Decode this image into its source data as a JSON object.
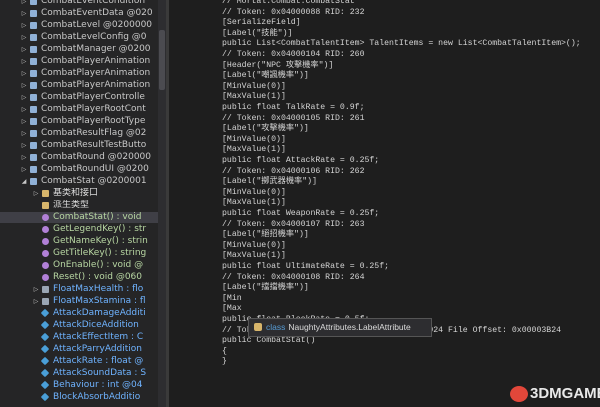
{
  "tree": {
    "rows": [
      {
        "label": "CombatEventCondition",
        "indent": 1,
        "icon": "cls",
        "style": "type",
        "expander": "▷"
      },
      {
        "label": "CombatEventData @020",
        "indent": 1,
        "icon": "cls",
        "style": "type",
        "expander": "▷"
      },
      {
        "label": "CombatLevel @0200000",
        "indent": 1,
        "icon": "cls",
        "style": "type",
        "expander": "▷"
      },
      {
        "label": "CombatLevelConfig @0",
        "indent": 1,
        "icon": "cls",
        "style": "type",
        "expander": "▷"
      },
      {
        "label": "CombatManager @0200",
        "indent": 1,
        "icon": "cls",
        "style": "type",
        "expander": "▷"
      },
      {
        "label": "CombatPlayerAnimation",
        "indent": 1,
        "icon": "cls",
        "style": "type",
        "expander": "▷"
      },
      {
        "label": "CombatPlayerAnimation",
        "indent": 1,
        "icon": "cls",
        "style": "type",
        "expander": "▷"
      },
      {
        "label": "CombatPlayerAnimation",
        "indent": 1,
        "icon": "cls",
        "style": "type",
        "expander": "▷"
      },
      {
        "label": "CombatPlayerControlle",
        "indent": 1,
        "icon": "cls",
        "style": "type",
        "expander": "▷"
      },
      {
        "label": "CombatPlayerRootCont",
        "indent": 1,
        "icon": "cls",
        "style": "type",
        "expander": "▷"
      },
      {
        "label": "CombatPlayerRootType",
        "indent": 1,
        "icon": "cls",
        "style": "type",
        "expander": "▷"
      },
      {
        "label": "CombatResultFlag @02",
        "indent": 1,
        "icon": "cls",
        "style": "type",
        "expander": "▷"
      },
      {
        "label": "CombatResultTestButto",
        "indent": 1,
        "icon": "cls",
        "style": "type",
        "expander": "▷"
      },
      {
        "label": "CombatRound @020000",
        "indent": 1,
        "icon": "cls",
        "style": "type",
        "expander": "▷"
      },
      {
        "label": "CombatRoundUI @0200",
        "indent": 1,
        "icon": "cls",
        "style": "type",
        "expander": "▷"
      },
      {
        "label": "CombatStat @0200001",
        "indent": 1,
        "icon": "cls",
        "style": "type",
        "expander": "◢"
      },
      {
        "label": "基类和接口",
        "indent": 2,
        "icon": "fold",
        "style": "folder",
        "expander": "▷"
      },
      {
        "label": "派生类型",
        "indent": 2,
        "icon": "fold",
        "style": "folder",
        "expander": ""
      },
      {
        "label": "CombatStat() : void",
        "indent": 2,
        "icon": "meth",
        "style": "method",
        "expander": "",
        "selected": true
      },
      {
        "label": "GetLegendKey() : str",
        "indent": 2,
        "icon": "meth",
        "style": "method",
        "expander": ""
      },
      {
        "label": "GetNameKey() : strin",
        "indent": 2,
        "icon": "meth",
        "style": "method",
        "expander": ""
      },
      {
        "label": "GetTitleKey() : string",
        "indent": 2,
        "icon": "meth",
        "style": "method",
        "expander": ""
      },
      {
        "label": "OnEnable() : void @",
        "indent": 2,
        "icon": "meth",
        "style": "method",
        "expander": ""
      },
      {
        "label": "Reset() : void @060",
        "indent": 2,
        "icon": "meth",
        "style": "method",
        "expander": ""
      },
      {
        "label": "FloatMaxHealth : flo",
        "indent": 2,
        "icon": "prop",
        "style": "field",
        "expander": "▷"
      },
      {
        "label": "FloatMaxStamina : fl",
        "indent": 2,
        "icon": "prop",
        "style": "field",
        "expander": "▷"
      },
      {
        "label": "AttackDamageAdditi",
        "indent": 2,
        "icon": "fld",
        "style": "field",
        "expander": ""
      },
      {
        "label": "AttackDiceAddition",
        "indent": 2,
        "icon": "fld",
        "style": "field",
        "expander": ""
      },
      {
        "label": "AttackEffectItem : C",
        "indent": 2,
        "icon": "fld",
        "style": "field",
        "expander": ""
      },
      {
        "label": "AttackParryAddition",
        "indent": 2,
        "icon": "fld",
        "style": "field",
        "expander": ""
      },
      {
        "label": "AttackRate : float @",
        "indent": 2,
        "icon": "fld",
        "style": "field",
        "expander": ""
      },
      {
        "label": "AttackSoundData : S",
        "indent": 2,
        "icon": "fld",
        "style": "field",
        "expander": ""
      },
      {
        "label": "Behaviour : int @04",
        "indent": 2,
        "icon": "fld",
        "style": "field",
        "expander": ""
      },
      {
        "label": "BlockAbsorbAdditio",
        "indent": 2,
        "icon": "fld",
        "style": "field",
        "expander": ""
      }
    ]
  },
  "gutter": {
    "numbers": [
      "",
      "",
      "",
      "",
      "",
      "",
      "",
      "",
      "",
      "",
      "",
      "",
      "",
      "",
      "",
      "",
      "",
      "",
      "",
      "",
      "",
      "",
      "",
      "",
      "",
      "",
      "",
      "",
      "",
      "",
      "",
      "",
      "",
      "",
      "",
      "",
      "",
      ""
    ]
  },
  "code": {
    "lines": [
      {
        "text": "// Mortal.Combat.CombatStat",
        "kind": "comment"
      },
      {
        "text": "// Token: 0x04000088 RID: 232",
        "kind": "comment"
      },
      {
        "text": "[SerializeField]",
        "kind": "attr"
      },
      {
        "text": "[Label(\"技能\")]",
        "kind": "attr"
      },
      {
        "text": "public List<CombatTalentItem> TalentItems = new List<CombatTalentItem>();",
        "kind": "kw"
      },
      {
        "text": "// Token: 0x04000104 RID: 260",
        "kind": "comment"
      },
      {
        "text": "[Header(\"NPC 攻擊機率\")]",
        "kind": "attr"
      },
      {
        "text": "[Label(\"嘲諷機率\")]",
        "kind": "attr"
      },
      {
        "text": "[MinValue(0)]",
        "kind": "attr"
      },
      {
        "text": "[MaxValue(1)]",
        "kind": "attr"
      },
      {
        "text": "public float TalkRate = 0.9f;",
        "kind": "kw"
      },
      {
        "text": "// Token: 0x04000105 RID: 261",
        "kind": "comment"
      },
      {
        "text": "[Label(\"攻擊機率\")]",
        "kind": "attr"
      },
      {
        "text": "[MinValue(0)]",
        "kind": "attr"
      },
      {
        "text": "[MaxValue(1)]",
        "kind": "attr"
      },
      {
        "text": "public float AttackRate = 0.25f;",
        "kind": "kw"
      },
      {
        "text": "// Token: 0x04000106 RID: 262",
        "kind": "comment"
      },
      {
        "text": "[Label(\"擲武器機率\")]",
        "kind": "attr"
      },
      {
        "text": "[MinValue(0)]",
        "kind": "attr"
      },
      {
        "text": "[MaxValue(1)]",
        "kind": "attr"
      },
      {
        "text": "public float WeaponRate = 0.25f;",
        "kind": "kw"
      },
      {
        "text": "// Token: 0x04000107 RID: 263",
        "kind": "comment"
      },
      {
        "text": "[Label(\"絕招機率\")]",
        "kind": "attr"
      },
      {
        "text": "[MinValue(0)]",
        "kind": "attr"
      },
      {
        "text": "[MaxValue(1)]",
        "kind": "attr"
      },
      {
        "text": "public float UltimateRate = 0.25f;",
        "kind": "kw"
      },
      {
        "text": "// Token: 0x04000108 RID: 264",
        "kind": "comment"
      },
      {
        "text": "[Label(\"擋擋機率\")]",
        "kind": "attr"
      },
      {
        "text": "[Min",
        "kind": "attr"
      },
      {
        "text": "[Max",
        "kind": "attr"
      },
      {
        "text": "public float BlockRate = 0.5f;",
        "kind": "kw"
      },
      {
        "text": "// Token: 0x060001C7 RID: 455 RVA: 0x00005924 File Offset: 0x00003B24",
        "kind": "comment"
      },
      {
        "text": "public CombatStat()",
        "kind": "kw"
      },
      {
        "text": "{",
        "kind": "kw"
      },
      {
        "text": "}",
        "kind": "kw"
      },
      {
        "text": "",
        "kind": "kw"
      }
    ]
  },
  "tooltip": {
    "keyword": "class",
    "name": "NaughtyAttributes.LabelAttribute"
  },
  "watermark": {
    "text": "3DMGAME"
  },
  "colors": {
    "background": "#1e1e1e",
    "comment": "#57a64a",
    "line_number": "#2b91af",
    "selection": "#3f3f46"
  }
}
